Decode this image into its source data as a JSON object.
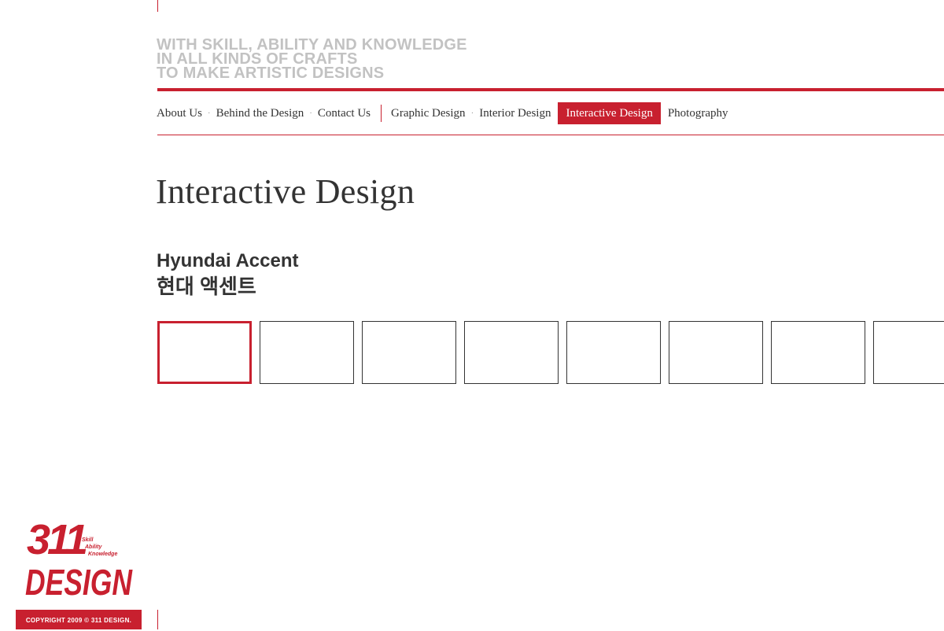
{
  "tagline": {
    "line1": "WITH SKILL, ABILITY AND KNOWLEDGE",
    "line2": "IN ALL KINDS OF CRAFTS",
    "line3": "TO MAKE ARTISTIC DESIGNS"
  },
  "nav": {
    "about": "About Us",
    "behind": "Behind the Design",
    "contact": "Contact Us",
    "graphic": "Graphic Design",
    "interior": "Interior Design",
    "interactive": "Interactive Design",
    "photography": "Photography",
    "separator": "·",
    "active_item": "Interactive Design"
  },
  "page_title": "Interactive Design",
  "project": {
    "name_en": "Hyundai Accent",
    "name_ko": "현대 액센트",
    "thumbnail_count": 8,
    "selected_thumbnail": 1
  },
  "logo": {
    "number": "311",
    "word": "DESIGN",
    "taglines": [
      "Skill",
      "Ability",
      "Knowledge"
    ]
  },
  "footer": {
    "copyright": "COPYRIGHT 2009 © 311 DESIGN."
  },
  "colors": {
    "accent": "#c8202f",
    "tagline_gray": "#c2c2c2",
    "text": "#333333"
  }
}
